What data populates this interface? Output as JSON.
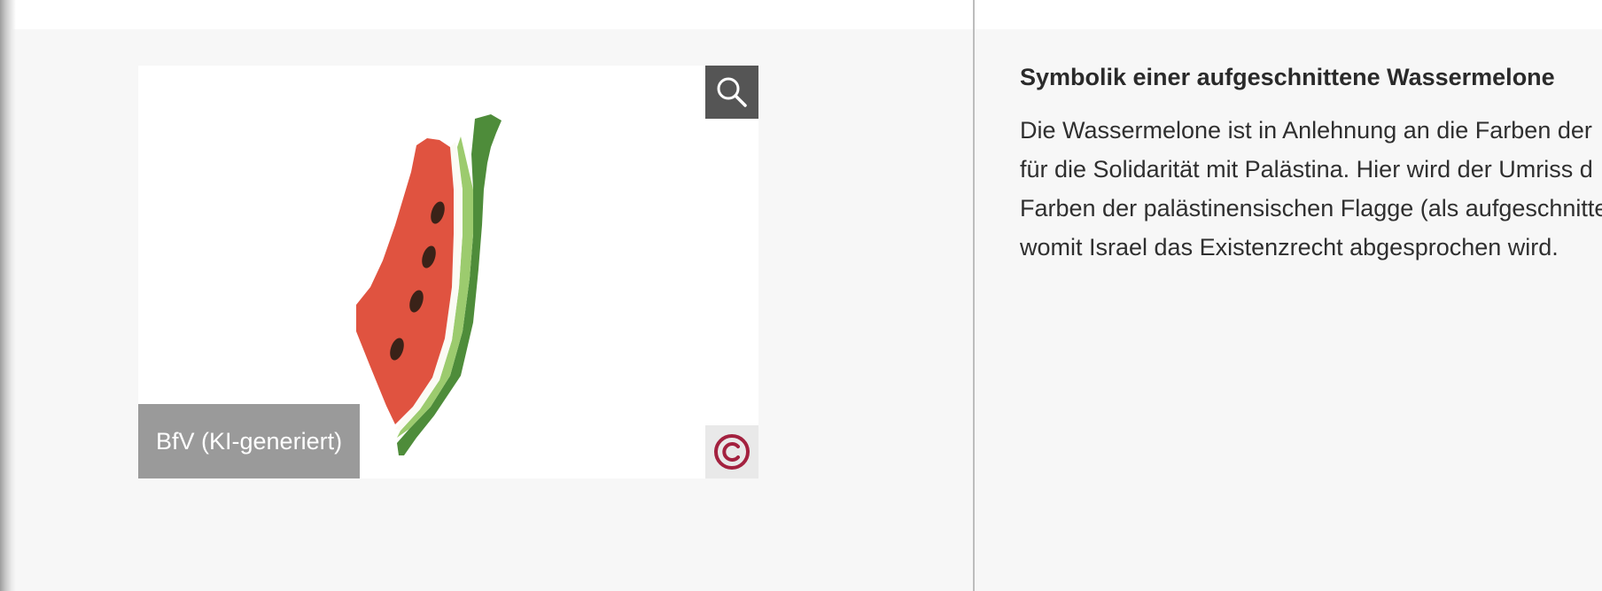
{
  "image": {
    "credit": "BfV (KI-generiert)",
    "zoom_icon": "search-icon",
    "copyright_icon": "copyright-icon",
    "colors": {
      "flesh": "#e05340",
      "rind_dark": "#4e8c3a",
      "rind_light": "#9ccb6e",
      "seeds": "#3a2218",
      "copyright": "#a3213f"
    }
  },
  "article": {
    "title": "Symbolik einer aufgeschnittene Wassermelone",
    "lines": [
      "Die Wassermelone ist in Anlehnung an die Farben der",
      "für die Solidarität mit Palästina. Hier wird der Umriss d",
      "Farben der palästinensischen Flagge (als aufgeschnitte",
      "womit Israel das Existenzrecht abgesprochen wird."
    ]
  }
}
